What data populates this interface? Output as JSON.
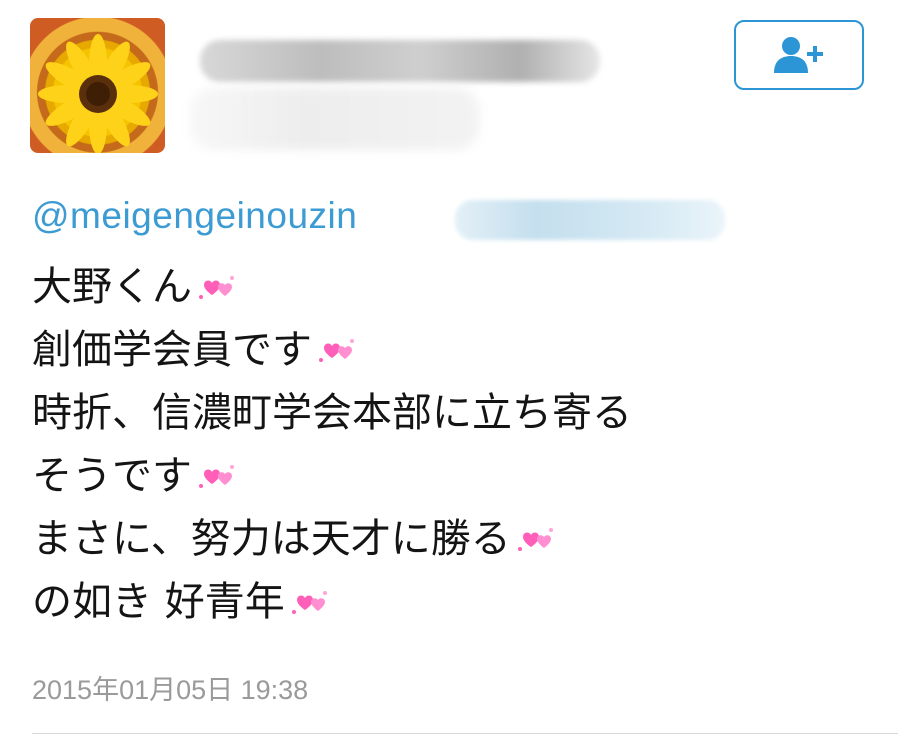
{
  "header": {
    "avatar_icon": "sunflower-avatar",
    "follow_icon": "add-user-icon"
  },
  "tweet": {
    "handle": "@meigengeinouzin",
    "lines": [
      "大野くん",
      "創価学会員です",
      "時折、信濃町学会本部に立ち寄る",
      "そうです",
      "まさに、努力は天才に勝る",
      "の如き 好青年"
    ],
    "heart_icon": "sparkling-hearts-emoji",
    "timestamp": "2015年01月05日 19:38"
  },
  "colors": {
    "accent": "#2c95d6",
    "handle": "#3c9bd3",
    "text": "#141414",
    "muted": "#9a9a9a",
    "heart": "#ff5fb8"
  }
}
